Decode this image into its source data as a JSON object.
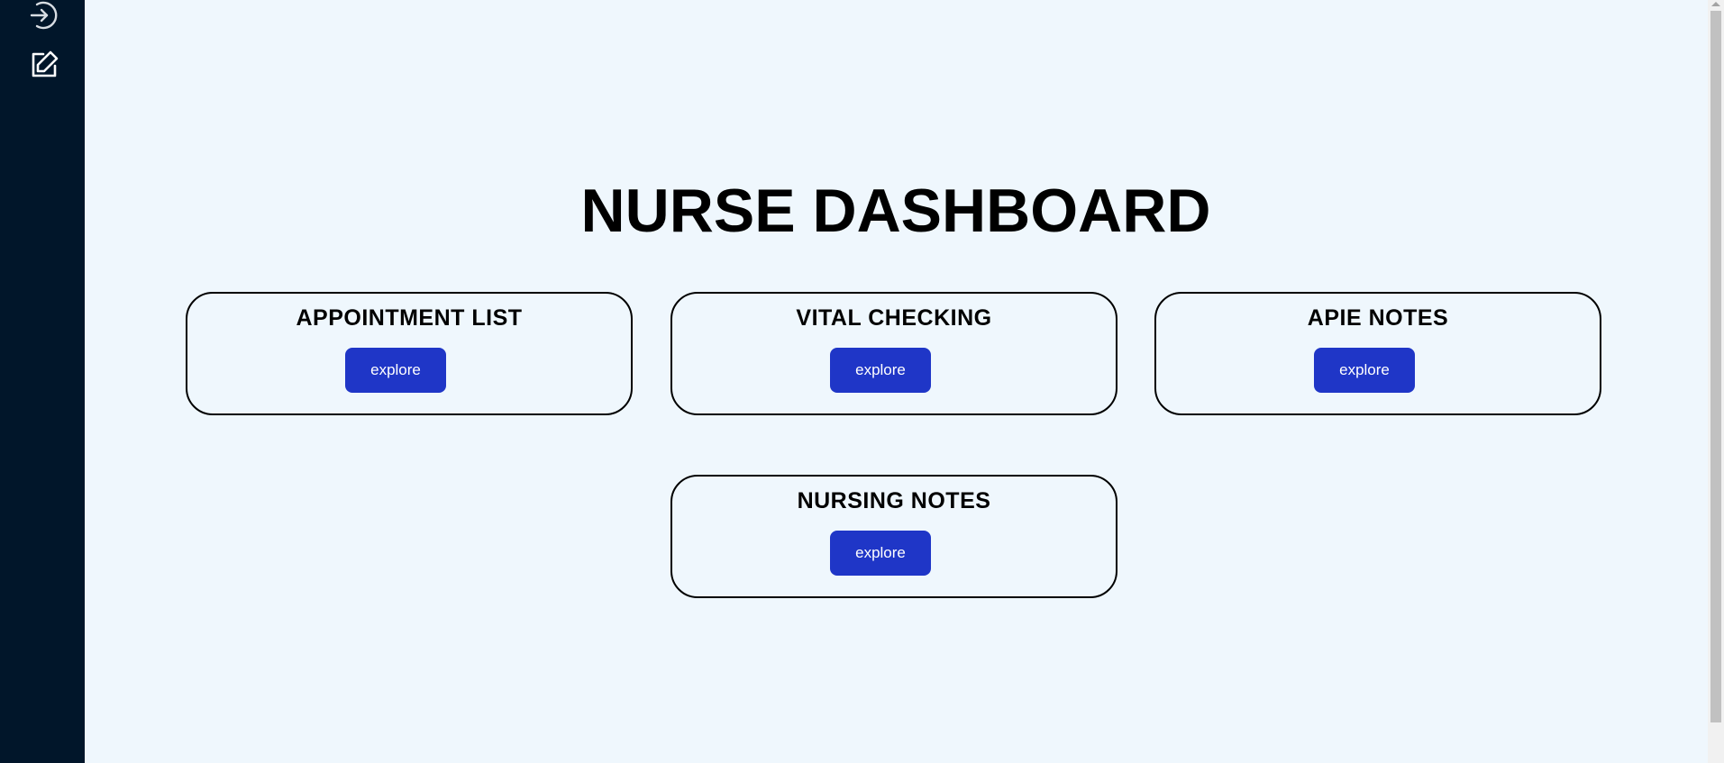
{
  "sidebar": {
    "icons": [
      {
        "name": "login-icon"
      },
      {
        "name": "edit-icon"
      }
    ]
  },
  "main": {
    "title": "NURSE DASHBOARD",
    "cards": [
      {
        "title": "APPOINTMENT LIST",
        "button": "explore"
      },
      {
        "title": "VITAL CHECKING",
        "button": "explore"
      },
      {
        "title": "APIE NOTES",
        "button": "explore"
      },
      {
        "title": "NURSING NOTES",
        "button": "explore"
      }
    ]
  },
  "colors": {
    "sidebar_bg": "#01162a",
    "page_bg": "#eff7fd",
    "button_bg": "#1f36c7",
    "button_text": "#ffffff"
  }
}
